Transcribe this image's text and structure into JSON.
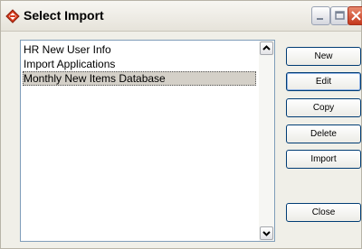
{
  "window": {
    "title": "Select Import",
    "icon": "app-diamond-icon"
  },
  "list": {
    "items": [
      {
        "label": "HR New User Info",
        "selected": false
      },
      {
        "label": "Import Applications",
        "selected": false
      },
      {
        "label": "Monthly New Items Database",
        "selected": true
      }
    ]
  },
  "buttons": {
    "new_label": "New",
    "edit_label": "Edit",
    "copy_label": "Copy",
    "delete_label": "Delete",
    "import_label": "Import",
    "close_label": "Close"
  },
  "colors": {
    "close_button": "#c4381c",
    "selection": "#d4d0c8",
    "accent_border": "#003c74"
  }
}
